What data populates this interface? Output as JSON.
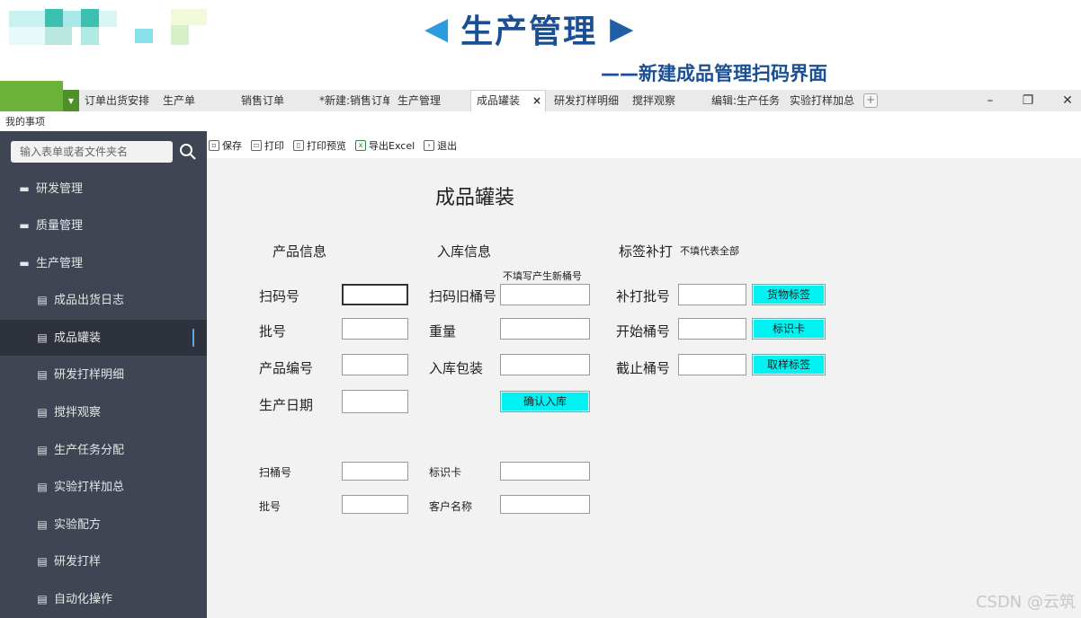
{
  "banner": {
    "title": "生产管理",
    "left_arrow": "◀",
    "right_arrow": "▶",
    "subtitle": "——新建成品管理扫码界面"
  },
  "tabs": [
    {
      "label": "订单出货安排",
      "active": false
    },
    {
      "label": "生产单",
      "active": false
    },
    {
      "label": "销售订单",
      "active": false
    },
    {
      "label": "*新建:销售订单",
      "active": false
    },
    {
      "label": "生产管理",
      "active": false
    },
    {
      "label": "成品罐装",
      "active": true
    },
    {
      "label": "研发打样明细",
      "active": false
    },
    {
      "label": "搅拌观察",
      "active": false
    },
    {
      "label": "编辑:生产任务",
      "active": false
    },
    {
      "label": "实验打样加总",
      "active": false
    }
  ],
  "tab_close": "×",
  "add_tab": "+",
  "window": {
    "minimize": "–",
    "restore": "❐",
    "close": "✕"
  },
  "my_items": "我的事项",
  "sidebar": {
    "search_placeholder": "输入表单或者文件夹名",
    "items": [
      {
        "label": "研发管理",
        "type": "group",
        "icon": "folder-icon"
      },
      {
        "label": "质量管理",
        "type": "group",
        "icon": "folder-icon"
      },
      {
        "label": "生产管理",
        "type": "group",
        "icon": "folder-icon"
      },
      {
        "label": "成品出货日志",
        "type": "leaf",
        "icon": "document-icon"
      },
      {
        "label": "成品罐装",
        "type": "leaf",
        "icon": "document-icon",
        "selected": true
      },
      {
        "label": "研发打样明细",
        "type": "leaf",
        "icon": "document-icon"
      },
      {
        "label": "搅拌观察",
        "type": "leaf",
        "icon": "document-icon"
      },
      {
        "label": "生产任务分配",
        "type": "leaf",
        "icon": "document-icon"
      },
      {
        "label": "实验打样加总",
        "type": "leaf",
        "icon": "document-icon"
      },
      {
        "label": "实验配方",
        "type": "leaf",
        "icon": "document-icon"
      },
      {
        "label": "研发打样",
        "type": "leaf",
        "icon": "document-icon"
      },
      {
        "label": "自动化操作",
        "type": "leaf",
        "icon": "document-icon"
      }
    ]
  },
  "toolbar": {
    "save": "保存",
    "print": "打印",
    "print_preview": "打印预览",
    "export_excel": "导出Excel",
    "exit": "退出"
  },
  "form": {
    "title": "成品罐装",
    "section_product": "产品信息",
    "section_storage": "入库信息",
    "section_label": "标签补打",
    "label_hint": "不填代表全部",
    "storage_hint": "不填写产生新桶号",
    "scan_no": "扫码号",
    "batch_no": "批号",
    "product_code": "产品编号",
    "production_date": "生产日期",
    "scan_old_bucket": "扫码旧桶号",
    "weight": "重量",
    "package": "入库包装",
    "confirm_button": "确认入库",
    "reprint_batch": "补打批号",
    "start_bucket": "开始桶号",
    "end_bucket": "截止桶号",
    "goods_label_button": "货物标签",
    "id_card_button": "标识卡",
    "sample_label_button": "取样标签",
    "scan_bucket": "扫桶号",
    "batch_no_2": "批号",
    "id_card": "标识卡",
    "customer_name": "客户名称"
  },
  "watermark": "CSDN @云筑"
}
